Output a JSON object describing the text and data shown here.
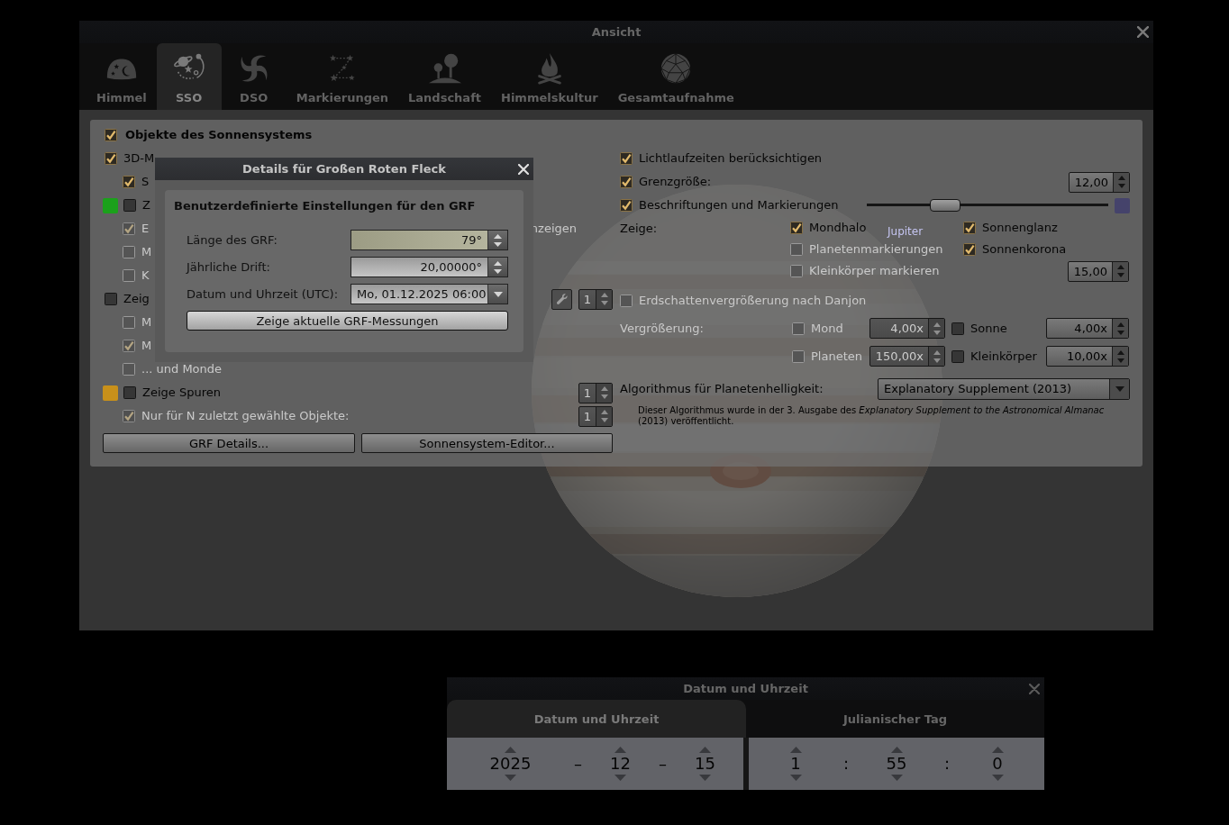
{
  "window": {
    "title": "Ansicht",
    "tabs": [
      {
        "label": "Himmel",
        "selected": false
      },
      {
        "label": "SSO",
        "selected": true
      },
      {
        "label": "DSO",
        "selected": false
      },
      {
        "label": "Markierungen",
        "selected": false
      },
      {
        "label": "Landschaft",
        "selected": false
      },
      {
        "label": "Himmelskultur",
        "selected": false
      },
      {
        "label": "Gesamtaufnahme",
        "selected": false
      }
    ]
  },
  "panel": {
    "header": {
      "label": "Objekte des Sonnensystems",
      "checked": true
    },
    "left": [
      {
        "label": "3D-M",
        "checked": true,
        "disabled": false,
        "children": [
          {
            "label": "S",
            "checked": true,
            "disabled": false
          }
        ]
      },
      {
        "label": "Z",
        "checked": false,
        "disabled": false,
        "color": "#1ba11b",
        "children": [
          {
            "label": "E",
            "label_end": "nzeigen",
            "checked": true,
            "disabled": true
          },
          {
            "label": "M",
            "checked": false,
            "disabled": true
          },
          {
            "label": "K",
            "checked": false,
            "disabled": true
          }
        ]
      },
      {
        "label": "Zeig",
        "checked": false,
        "disabled": false,
        "tool": {
          "disabled": true
        },
        "spin": {
          "value": "1",
          "disabled": true
        },
        "children": [
          {
            "label": "M",
            "checked": false,
            "disabled": true
          },
          {
            "label": "M",
            "checked": true,
            "disabled": true
          },
          {
            "label": "... und Monde",
            "checked": false,
            "disabled": true
          }
        ]
      },
      {
        "label": "Zeige Spuren",
        "checked": false,
        "disabled": false,
        "color": "#c8901a",
        "spin": {
          "value": "1",
          "disabled": true
        },
        "children": [
          {
            "label": "Nur für N zuletzt gewählte Objekte:",
            "checked": true,
            "disabled": true,
            "spin": {
              "value": "1",
              "disabled": true
            }
          }
        ]
      }
    ],
    "buttons": [
      {
        "label": "GRF Details..."
      },
      {
        "label": "Sonnensystem-Editor..."
      }
    ],
    "right": [
      {
        "kind": "check",
        "label": "Lichtlaufzeiten berücksichtigen",
        "checked": true,
        "disabled": false
      },
      {
        "kind": "check_spin",
        "label": "Grenzgröße:",
        "checked": true,
        "disabled": false,
        "spin": {
          "value": "12,00",
          "disabled": false
        }
      },
      {
        "kind": "check_slider",
        "label": "Beschriftungen und Markierungen",
        "checked": true,
        "disabled": false,
        "level": 0.3,
        "color": "#45436b"
      },
      {
        "kind": "options",
        "label": "Zeige:",
        "disabled": false,
        "rows": [
          [
            {
              "kind": "check",
              "label": "Mondhalo",
              "checked": true,
              "disabled": false
            },
            {
              "kind": "check",
              "label": "Sonnenglanz",
              "checked": true,
              "disabled": false
            }
          ],
          [
            {
              "kind": "check",
              "label": "Planetenmarkierungen",
              "checked": false,
              "disabled": true
            },
            {
              "kind": "check",
              "label": "Sonnenkorona",
              "checked": true,
              "disabled": false
            }
          ],
          [
            {
              "kind": "check",
              "label": "Kleinkörper markieren",
              "checked": false,
              "disabled": true
            },
            {
              "kind": "spin",
              "value": "15,00",
              "disabled": false
            }
          ]
        ]
      },
      {
        "kind": "check",
        "label": "Erdschattenvergrößerung nach Danjon",
        "checked": false,
        "disabled": true
      },
      {
        "kind": "magnification",
        "label": "Vergrößerung:",
        "disabled": true,
        "rows": [
          [
            {
              "label": "Mond",
              "checked": false,
              "disabled": true,
              "spin": {
                "value": "4,00x",
                "disabled": true
              }
            },
            {
              "label": "Sonne",
              "checked": false,
              "disabled": false,
              "spin": {
                "value": "4,00x",
                "disabled": false
              }
            }
          ],
          [
            {
              "label": "Planeten",
              "checked": false,
              "disabled": true,
              "spin": {
                "value": "150,00x",
                "disabled": true
              }
            },
            {
              "label": "Kleinkörper",
              "checked": false,
              "disabled": false,
              "spin": {
                "value": "10,00x",
                "disabled": false
              }
            }
          ]
        ]
      },
      {
        "kind": "combo",
        "label": "Algorithmus für Planetenhelligkeit:",
        "value": "Explanatory Supplement (2013)",
        "note": "Dieser Algorithmus wurde in der 3. Ausgabe des *Explanatory Supplement to the Astronomical Almanac* (2013) veröffentlicht."
      }
    ]
  },
  "sky": {
    "label": "Jupiter"
  },
  "grf_dialog": {
    "title": "Details für Großen Roten Fleck",
    "heading": "Benutzerdefinierte Einstellungen für den GRF",
    "fields": [
      {
        "kind": "spin",
        "label": "Länge des GRF:",
        "value": "79°",
        "focused": true
      },
      {
        "kind": "spin",
        "label": "Jährliche Drift:",
        "value": "20,00000°",
        "focused": false
      },
      {
        "kind": "combo",
        "label": "Datum und Uhrzeit (UTC):",
        "value": "Mo, 01.12.2025 06:00",
        "focused": false
      }
    ],
    "button": "Zeige aktuelle GRF-Messungen"
  },
  "date_window": {
    "title": "Datum und Uhrzeit",
    "tabs": [
      {
        "label": "Datum und Uhrzeit",
        "selected": true
      },
      {
        "label": "Julianischer Tag",
        "selected": false
      }
    ],
    "groups": [
      {
        "kind": "date",
        "parts": [
          {
            "kind": "number",
            "value": "2025"
          },
          {
            "kind": "separator",
            "value": "–"
          },
          {
            "kind": "number",
            "value": "12"
          },
          {
            "kind": "separator",
            "value": "–"
          },
          {
            "kind": "number",
            "value": "15"
          }
        ]
      },
      {
        "kind": "time",
        "parts": [
          {
            "kind": "number",
            "value": "1"
          },
          {
            "kind": "separator",
            "value": ":"
          },
          {
            "kind": "number",
            "value": "55"
          },
          {
            "kind": "separator",
            "value": ":"
          },
          {
            "kind": "number",
            "value": "0"
          }
        ]
      }
    ]
  }
}
